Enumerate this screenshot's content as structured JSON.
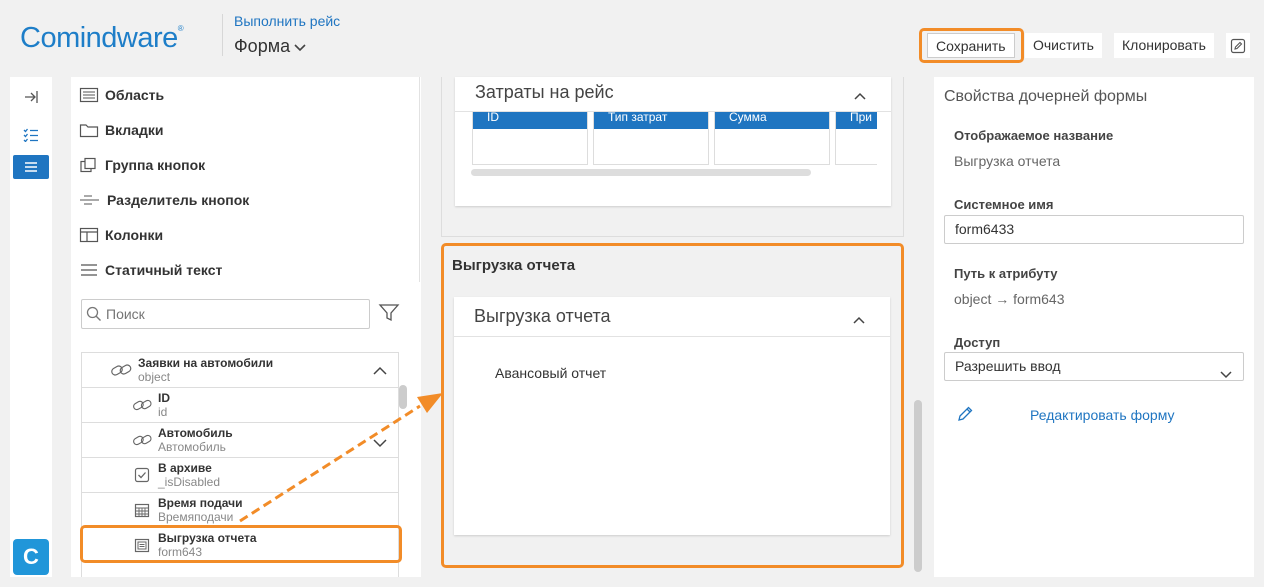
{
  "header": {
    "logo_text": "Comindware",
    "logo_mark": "®",
    "breadcrumb_link": "Выполнить рейс",
    "form_title": "Форма",
    "actions": {
      "save": "Сохранить",
      "clear": "Очистить",
      "clone": "Клонировать"
    }
  },
  "rail": {
    "logo_letter": "C"
  },
  "palette": {
    "items": [
      "Область",
      "Вкладки",
      "Группа кнопок",
      "Разделитель кнопок",
      "Колонки",
      "Статичный текст"
    ],
    "search_placeholder": "Поиск",
    "tree": [
      {
        "name": "Заявки на автомобили",
        "system": "object"
      },
      {
        "name": "ID",
        "system": "id"
      },
      {
        "name": "Автомобиль",
        "system": "Автомобиль"
      },
      {
        "name": "В архиве",
        "system": "_isDisabled"
      },
      {
        "name": "Время подачи",
        "system": "Времяподачи"
      },
      {
        "name": "Выгрузка отчета",
        "system": "form643"
      }
    ]
  },
  "canvas": {
    "card1": {
      "title": "Затраты на рейс",
      "columns": [
        "ID",
        "Тип затрат",
        "Сумма",
        "При"
      ]
    },
    "section_title": "Выгрузка отчета",
    "card2": {
      "title": "Выгрузка отчета",
      "body_text": "Авансовый отчет"
    }
  },
  "properties": {
    "title": "Свойства дочерней формы",
    "display_name_label": "Отображаемое название",
    "display_name_value": "Выгрузка отчета",
    "system_name_label": "Системное имя",
    "system_name_value": "form6433",
    "path_label": "Путь к атрибуту",
    "path_value": "object → form643",
    "access_label": "Доступ",
    "access_value": "Разрешить ввод",
    "edit_form_link": "Редактировать форму"
  },
  "colors": {
    "accent": "#1f75c1",
    "highlight": "#f28c28"
  }
}
